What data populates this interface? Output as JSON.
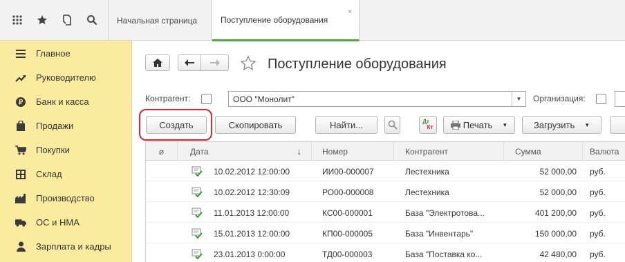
{
  "topbar": {
    "tabs": [
      {
        "label": "Начальная страница"
      },
      {
        "label": "Поступление оборудования",
        "close": "×"
      }
    ]
  },
  "sidebar": {
    "items": [
      {
        "label": "Главное",
        "icon": "menu-lines-icon"
      },
      {
        "label": "Руководителю",
        "icon": "trend-up-icon"
      },
      {
        "label": "Банк и касса",
        "icon": "ruble-coin-icon"
      },
      {
        "label": "Продажи",
        "icon": "shopping-bag-icon"
      },
      {
        "label": "Покупки",
        "icon": "shopping-cart-icon"
      },
      {
        "label": "Склад",
        "icon": "warehouse-icon"
      },
      {
        "label": "Производство",
        "icon": "factory-icon"
      },
      {
        "label": "ОС и НМА",
        "icon": "truck-icon"
      },
      {
        "label": "Зарплата и кадры",
        "icon": "person-icon"
      }
    ]
  },
  "page": {
    "title": "Поступление оборудования"
  },
  "filters": {
    "counterparty_label": "Контрагент:",
    "counterparty_value": "ООО \"Монолит\"",
    "organization_label": "Организация:"
  },
  "toolbar": {
    "create": "Создать",
    "copy": "Скопировать",
    "find": "Найти...",
    "dtkt_top": "Дт",
    "dtkt_bottom": "Кт",
    "print": "Печать",
    "load": "Загрузить"
  },
  "table": {
    "columns": [
      "Дата",
      "Номер",
      "Контрагент",
      "Сумма",
      "Валюта"
    ],
    "sort_arrow": "↓",
    "attach_symbol": "⌀",
    "rows": [
      {
        "date": "10.02.2012 12:00:00",
        "number": "ИИ00-000007",
        "counterparty": "Лестехника",
        "sum": "52 000,00",
        "currency": "руб."
      },
      {
        "date": "10.02.2012 12:30:09",
        "number": "РО00-000008",
        "counterparty": "Лестехника",
        "sum": "52 000,00",
        "currency": "руб."
      },
      {
        "date": "11.01.2013 12:00:00",
        "number": "КС00-000001",
        "counterparty": "База \"Электротова...",
        "sum": "401 200,00",
        "currency": "руб."
      },
      {
        "date": "15.01.2013 12:00:00",
        "number": "КП00-000005",
        "counterparty": "База \"Инвентарь\"",
        "sum": "150 000,00",
        "currency": "руб."
      },
      {
        "date": "23.01.2013 0:00:00",
        "number": "ТД00-000003",
        "counterparty": "База \"Поставка ко...",
        "sum": "42 480,00",
        "currency": "руб."
      }
    ]
  },
  "colors": {
    "sidebar_bg": "#fbeb9f",
    "active_tab_underline": "#4caa3b",
    "highlight": "#d9262b"
  }
}
